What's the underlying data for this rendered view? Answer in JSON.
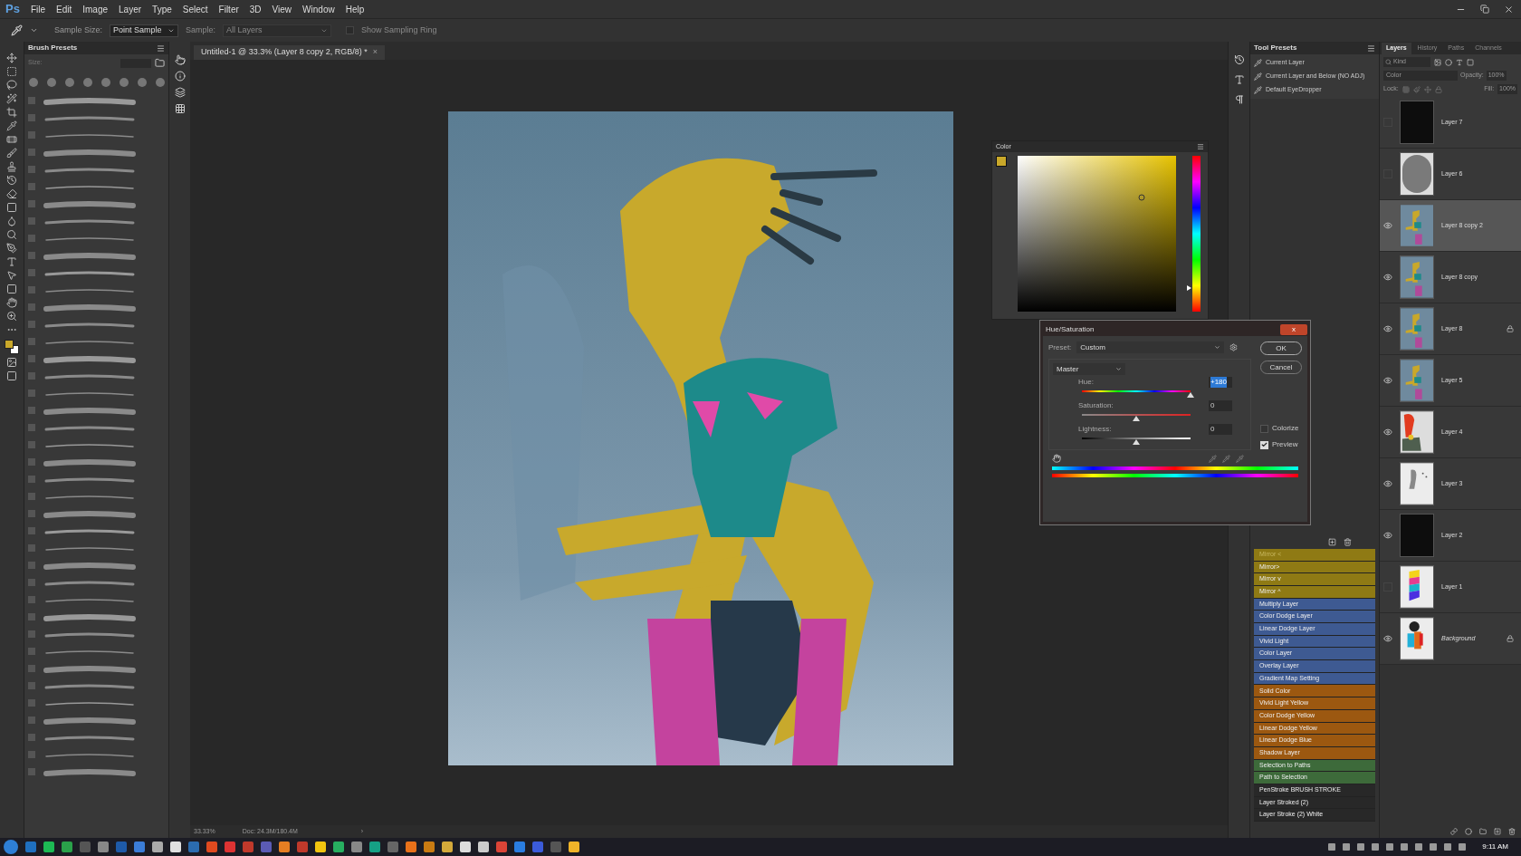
{
  "app_logo": "Ps",
  "menu": [
    "File",
    "Edit",
    "Image",
    "Layer",
    "Type",
    "Select",
    "Filter",
    "3D",
    "View",
    "Window",
    "Help"
  ],
  "options_bar": {
    "sample_size_label": "Sample Size:",
    "sample_size": "Point Sample",
    "sample_label": "Sample:",
    "sample": "All Layers",
    "sample_disabled": true,
    "sampling_ring": {
      "label": "Show Sampling Ring",
      "checked": false,
      "disabled": true
    }
  },
  "brush_presets": {
    "title": "Brush Presets",
    "size_label": "Size:"
  },
  "document_tab": {
    "title": "Untitled-1 @ 33.3% (Layer 8 copy 2, RGB/8) *",
    "close": "×"
  },
  "status_bar": {
    "zoom": "33.33%",
    "doc": "Doc: 24.3M/180.4M",
    "arrow": "›"
  },
  "color_panel": {
    "title": "Color"
  },
  "hue_saturation": {
    "title": "Hue/Saturation",
    "close": "x",
    "preset_label": "Preset:",
    "preset": "Custom",
    "ok": "OK",
    "cancel": "Cancel",
    "channel": "Master",
    "sliders": [
      {
        "kind": "hue",
        "label": "Hue:",
        "value": "+180",
        "value_selected": true,
        "level": 1.0
      },
      {
        "kind": "saturation",
        "label": "Saturation:",
        "value": "0",
        "value_selected": false,
        "level": 0.5
      },
      {
        "kind": "lightness",
        "label": "Lightness:",
        "value": "0",
        "value_selected": false,
        "level": 0.5
      }
    ],
    "colorize": {
      "label": "Colorize",
      "checked": false
    },
    "preview": {
      "label": "Preview",
      "checked": true
    }
  },
  "tool_presets": {
    "title": "Tool Presets",
    "items": [
      "Current Layer",
      "Current Layer and Below (NO ADJ)",
      "Default EyeDropper"
    ]
  },
  "actions": [
    {
      "label": "Mirror <",
      "color": "#8f7a14",
      "faded": true
    },
    {
      "label": "Mirror>",
      "color": "#8f7a14",
      "faded": false
    },
    {
      "label": "Mirror v",
      "color": "#8f7a14",
      "faded": false
    },
    {
      "label": "Mirror ^",
      "color": "#8f7a14",
      "faded": false
    },
    {
      "label": "Multiply Layer",
      "color": "#3e5a92",
      "faded": false
    },
    {
      "label": "Color Dodge Layer",
      "color": "#3e5a92",
      "faded": false
    },
    {
      "label": "Linear Dodge Layer",
      "color": "#3e5a92",
      "faded": false
    },
    {
      "label": "Vivid Light",
      "color": "#3e5a92",
      "faded": false
    },
    {
      "label": "Color Layer",
      "color": "#3e5a92",
      "faded": false
    },
    {
      "label": "Overlay Layer",
      "color": "#3e5a92",
      "faded": false
    },
    {
      "label": "Gradient Map Setting",
      "color": "#3e5a92",
      "faded": false
    },
    {
      "label": "Solid Color",
      "color": "#9c5810",
      "faded": false
    },
    {
      "label": "Vivid Light Yellow",
      "color": "#9c5810",
      "faded": false
    },
    {
      "label": "Color Dodge Yellow",
      "color": "#9c5810",
      "faded": false
    },
    {
      "label": "Linear Dodge Yellow",
      "color": "#9c5810",
      "faded": false
    },
    {
      "label": "Linear Dodge Blue",
      "color": "#9c5810",
      "faded": false
    },
    {
      "label": "Shadow Layer",
      "color": "#9c5810",
      "faded": false
    },
    {
      "label": "Selection to Paths",
      "color": "#3d6a3a",
      "faded": false
    },
    {
      "label": "Path to Selection",
      "color": "#3d6a3a",
      "faded": false
    },
    {
      "label": "PenStroke BRUSH STROKE",
      "color": "#282828",
      "faded": false
    },
    {
      "label": "Layer Stroked (2)",
      "color": "#282828",
      "faded": false
    },
    {
      "label": "Layer Stroke (2) White",
      "color": "#282828",
      "faded": false
    }
  ],
  "layers_panel": {
    "tabs": [
      {
        "label": "Layers",
        "selected": true
      },
      {
        "label": "History",
        "selected": false
      },
      {
        "label": "Paths",
        "selected": false
      },
      {
        "label": "Channels",
        "selected": false
      }
    ],
    "filter_placeholder": "Kind",
    "blend_mode": "Color",
    "opacity_label": "Opacity:",
    "opacity": "100%",
    "lock_label": "Lock:",
    "fill_label": "Fill:",
    "fill": "100%",
    "layers": [
      {
        "name": "Layer 7",
        "kind": "black",
        "visible": false,
        "selected": false,
        "locked": false,
        "italic": false
      },
      {
        "name": "Layer 6",
        "kind": "oval",
        "visible": false,
        "selected": false,
        "locked": false,
        "italic": false
      },
      {
        "name": "Layer 8 copy 2",
        "kind": "painting",
        "visible": true,
        "selected": true,
        "locked": false,
        "italic": false
      },
      {
        "name": "Layer 8 copy",
        "kind": "painting",
        "visible": true,
        "selected": false,
        "locked": false,
        "italic": false
      },
      {
        "name": "Layer 8",
        "kind": "painting",
        "visible": true,
        "selected": false,
        "locked": true,
        "italic": false
      },
      {
        "name": "Layer 5",
        "kind": "painting",
        "visible": true,
        "selected": false,
        "locked": false,
        "italic": false
      },
      {
        "name": "Layer 4",
        "kind": "red",
        "visible": true,
        "selected": false,
        "locked": false,
        "italic": false
      },
      {
        "name": "Layer 3",
        "kind": "sketch",
        "visible": true,
        "selected": false,
        "locked": false,
        "italic": false
      },
      {
        "name": "Layer 2",
        "kind": "black",
        "visible": true,
        "selected": false,
        "locked": false,
        "italic": false
      },
      {
        "name": "Layer 1",
        "kind": "stripes",
        "visible": false,
        "selected": false,
        "locked": false,
        "italic": false
      },
      {
        "name": "Background",
        "kind": "figure",
        "visible": true,
        "selected": false,
        "locked": true,
        "italic": true
      }
    ]
  },
  "taskbar": {
    "time": "9:11 AM"
  }
}
